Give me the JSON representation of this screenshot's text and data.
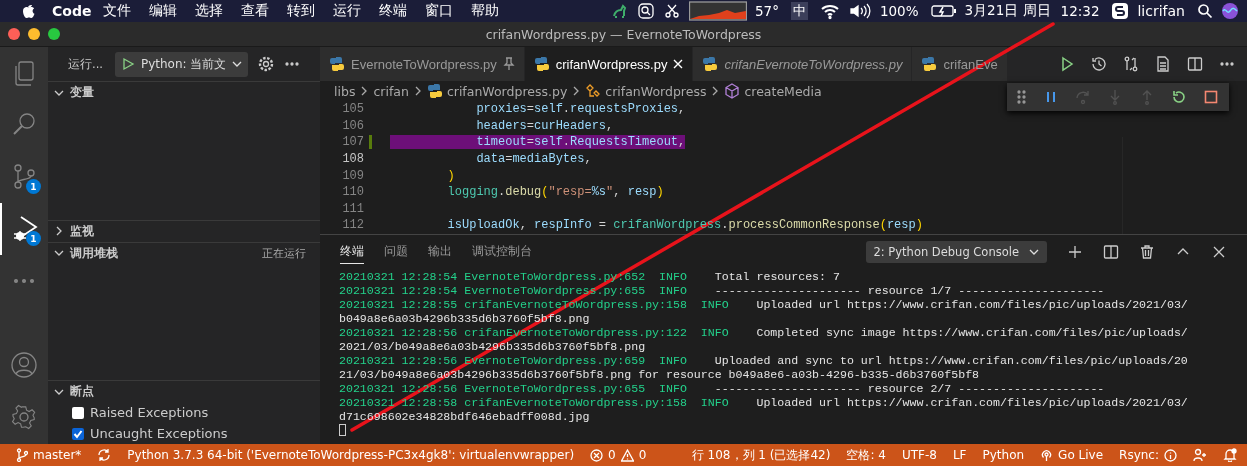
{
  "menubar": {
    "app": "Code",
    "menus": [
      "文件",
      "编辑",
      "选择",
      "查看",
      "转到",
      "运行",
      "终端",
      "窗口",
      "帮助"
    ],
    "status": {
      "temperature": "57°",
      "input_method": "中",
      "battery": "100%",
      "date": "3月21日 周日",
      "time": "12:32",
      "user": "licrifan"
    }
  },
  "window": {
    "title": "crifanWordpress.py — EvernoteToWordpress"
  },
  "activity_bar": {
    "items": [
      {
        "kind": "explorer",
        "selected": false
      },
      {
        "kind": "search",
        "selected": false
      },
      {
        "kind": "source_control",
        "selected": false,
        "badge": "1"
      },
      {
        "kind": "debug",
        "selected": true,
        "badge": "1"
      },
      {
        "kind": "more",
        "selected": false
      }
    ],
    "bottom": [
      {
        "kind": "account"
      },
      {
        "kind": "settings"
      }
    ]
  },
  "sidebar": {
    "toolbar": {
      "label": "运行...",
      "config": "Python: 当前文"
    },
    "sections": [
      {
        "title": "变量",
        "expanded": true
      },
      {
        "title": "监视",
        "expanded": false
      },
      {
        "title": "调用堆栈",
        "expanded": true,
        "badge": "正在运行"
      },
      {
        "title": "断点",
        "expanded": true,
        "items": [
          {
            "label": "Raised Exceptions",
            "checked": false
          },
          {
            "label": "Uncaught Exceptions",
            "checked": true
          }
        ]
      }
    ]
  },
  "tabs": [
    {
      "label": "EvernoteToWordpress.py",
      "selected": false,
      "preview": false,
      "pinned": true
    },
    {
      "label": "crifanWordpress.py",
      "selected": true,
      "preview": false,
      "pinned": false
    },
    {
      "label": "crifanEvernoteToWordpress.py",
      "selected": false,
      "preview": true,
      "pinned": false
    },
    {
      "label": "crifanEve",
      "selected": false,
      "preview": false,
      "pinned": false
    }
  ],
  "breadcrumb": [
    {
      "kind": "folder",
      "text": "libs"
    },
    {
      "kind": "folder",
      "text": "crifan"
    },
    {
      "kind": "python",
      "text": "crifanWordpress.py"
    },
    {
      "kind": "class",
      "text": "crifanWordpress"
    },
    {
      "kind": "method",
      "text": "createMedia"
    }
  ],
  "debug_toolbar": [
    {
      "kind": "pause",
      "disabled": false
    },
    {
      "kind": "step_over",
      "disabled": true
    },
    {
      "kind": "step_into",
      "disabled": true
    },
    {
      "kind": "step_out",
      "disabled": true
    },
    {
      "kind": "restart",
      "disabled": false
    },
    {
      "kind": "stop",
      "disabled": false
    }
  ],
  "code": [
    {
      "number": "105",
      "kind": "argument",
      "current": false,
      "selected": false,
      "modified": false,
      "tokens": [
        {
          "kind": "param",
          "text": "proxies"
        },
        {
          "kind": "plain",
          "text": "="
        },
        {
          "kind": "var",
          "text": "self"
        },
        {
          "kind": "plain",
          "text": "."
        },
        {
          "kind": "var",
          "text": "requestsProxies"
        },
        {
          "kind": "plain",
          "text": ","
        }
      ]
    },
    {
      "number": "106",
      "kind": "argument",
      "current": false,
      "selected": false,
      "modified": false,
      "tokens": [
        {
          "kind": "param",
          "text": "headers"
        },
        {
          "kind": "plain",
          "text": "="
        },
        {
          "kind": "var",
          "text": "curHeaders"
        },
        {
          "kind": "plain",
          "text": ","
        }
      ]
    },
    {
      "number": "107",
      "kind": "argument",
      "current": false,
      "selected": true,
      "modified": true,
      "tokens": [
        {
          "kind": "param",
          "text": "timeout"
        },
        {
          "kind": "plain",
          "text": "="
        },
        {
          "kind": "var",
          "text": "self"
        },
        {
          "kind": "plain",
          "text": "."
        },
        {
          "kind": "var",
          "text": "RequestsTimeout"
        },
        {
          "kind": "plain",
          "text": ","
        }
      ]
    },
    {
      "number": "108",
      "kind": "argument",
      "current": true,
      "selected": false,
      "modified": false,
      "tokens": [
        {
          "kind": "param",
          "text": "data"
        },
        {
          "kind": "plain",
          "text": "="
        },
        {
          "kind": "var",
          "text": "mediaBytes"
        },
        {
          "kind": "plain",
          "text": ","
        }
      ]
    },
    {
      "number": "109",
      "kind": "statement",
      "current": false,
      "selected": false,
      "modified": false,
      "tokens": [
        {
          "kind": "bracket",
          "text": ")"
        }
      ]
    },
    {
      "number": "110",
      "kind": "statement",
      "current": false,
      "selected": false,
      "modified": false,
      "tokens": [
        {
          "kind": "module",
          "text": "logging"
        },
        {
          "kind": "plain",
          "text": "."
        },
        {
          "kind": "func",
          "text": "debug"
        },
        {
          "kind": "bracket",
          "text": "("
        },
        {
          "kind": "string",
          "text": "\"resp="
        },
        {
          "kind": "param",
          "text": "%s"
        },
        {
          "kind": "string",
          "text": "\""
        },
        {
          "kind": "plain",
          "text": ", "
        },
        {
          "kind": "var",
          "text": "resp"
        },
        {
          "kind": "bracket",
          "text": ")"
        }
      ]
    },
    {
      "number": "111",
      "kind": "blank",
      "current": false,
      "modified": false
    },
    {
      "number": "112",
      "kind": "statement",
      "current": false,
      "selected": false,
      "modified": false,
      "tokens": [
        {
          "kind": "var",
          "text": "isUploadOk"
        },
        {
          "kind": "plain",
          "text": ", "
        },
        {
          "kind": "var",
          "text": "respInfo"
        },
        {
          "kind": "plain",
          "text": " = "
        },
        {
          "kind": "module",
          "text": "crifanWordpress"
        },
        {
          "kind": "plain",
          "text": "."
        },
        {
          "kind": "func",
          "text": "processCommonResponse"
        },
        {
          "kind": "bracket",
          "text": "("
        },
        {
          "kind": "var",
          "text": "resp"
        },
        {
          "kind": "bracket",
          "text": ")"
        }
      ]
    }
  ],
  "panel": {
    "tabs": [
      {
        "label": "终端",
        "selected": true
      },
      {
        "label": "问题",
        "selected": false
      },
      {
        "label": "输出",
        "selected": false
      },
      {
        "label": "调试控制台",
        "selected": false
      }
    ],
    "terminal_select": "2: Python Debug Console",
    "lines": [
      {
        "kind": "log",
        "time": "20210321 12:28:54",
        "source": "EvernoteToWordpress.py:652",
        "level": "INFO",
        "message": "Total resources: 7"
      },
      {
        "kind": "log",
        "time": "20210321 12:28:54",
        "source": "EvernoteToWordpress.py:655",
        "level": "INFO",
        "message": "--------------------- resource 1/7 ---------------------"
      },
      {
        "kind": "log",
        "time": "20210321 12:28:55",
        "source": "crifanEvernoteToWordpress.py:158",
        "level": "INFO",
        "message": "Uploaded url https://www.crifan.com/files/pic/uploads/2021/03/"
      },
      {
        "kind": "wrap",
        "text": "b049a8e6a03b4296b335d6b3760f5bf8.png"
      },
      {
        "kind": "log",
        "time": "20210321 12:28:56",
        "source": "crifanEvernoteToWordpress.py:122",
        "level": "INFO",
        "message": "Completed sync image https://www.crifan.com/files/pic/uploads/"
      },
      {
        "kind": "wrap",
        "text": "2021/03/b049a8e6a03b4296b335d6b3760f5bf8.png"
      },
      {
        "kind": "log",
        "time": "20210321 12:28:56",
        "source": "EvernoteToWordpress.py:659",
        "level": "INFO",
        "message": "Uploaded and sync to url https://www.crifan.com/files/pic/uploads/20"
      },
      {
        "kind": "wrap",
        "text": "21/03/b049a8e6a03b4296b335d6b3760f5bf8.png for resource b049a8e6-a03b-4296-b335-d6b3760f5bf8"
      },
      {
        "kind": "log",
        "time": "20210321 12:28:56",
        "source": "EvernoteToWordpress.py:655",
        "level": "INFO",
        "message": "--------------------- resource 2/7 ---------------------"
      },
      {
        "kind": "log",
        "time": "20210321 12:28:58",
        "source": "crifanEvernoteToWordpress.py:158",
        "level": "INFO",
        "message": "Uploaded url https://www.crifan.com/files/pic/uploads/2021/03/"
      },
      {
        "kind": "wrap",
        "text": "d71c698602e34828bdf646ebadff008d.jpg"
      },
      {
        "kind": "cursor"
      }
    ]
  },
  "status_bar": {
    "left": [
      {
        "kind": "branch",
        "text": "master*"
      },
      {
        "kind": "sync"
      },
      {
        "kind": "text",
        "text": "Python 3.7.3 64-bit ('EvernoteToWordpress-PC3x4gk8': virtualenvwrapper)"
      },
      {
        "kind": "problems",
        "errors": "0",
        "warnings": "0"
      }
    ],
    "right": [
      {
        "kind": "text",
        "text": "行 108，列 1 (已选择42)"
      },
      {
        "kind": "text",
        "text": "空格: 4"
      },
      {
        "kind": "text",
        "text": "UTF-8"
      },
      {
        "kind": "text",
        "text": "LF"
      },
      {
        "kind": "text",
        "text": "Python"
      },
      {
        "kind": "golive",
        "text": "Go Live"
      },
      {
        "kind": "rsync",
        "text": "Rsync:"
      },
      {
        "kind": "feedback"
      },
      {
        "kind": "bell"
      }
    ]
  },
  "annotations": [
    {
      "kind": "line",
      "color": "#e8131b"
    }
  ]
}
